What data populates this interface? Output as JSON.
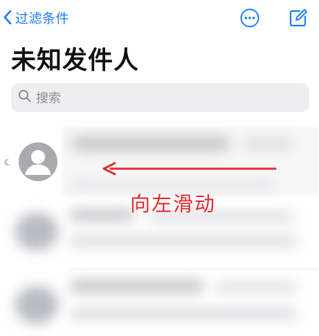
{
  "nav": {
    "back_label": "过滤条件",
    "more_icon": "ellipsis-circle-icon",
    "compose_icon": "compose-icon",
    "accent_color": "#1a7bff"
  },
  "page": {
    "title": "未知发件人"
  },
  "search": {
    "placeholder": "搜索",
    "icon": "search-icon"
  },
  "messages": [
    {
      "state": "blurred",
      "avatar_icon": "person-avatar-icon",
      "unread": true
    },
    {
      "state": "blurred"
    },
    {
      "state": "blurred"
    }
  ],
  "annotation": {
    "text": "向左滑动",
    "arrow_direction": "left",
    "color": "#e32b2b"
  }
}
